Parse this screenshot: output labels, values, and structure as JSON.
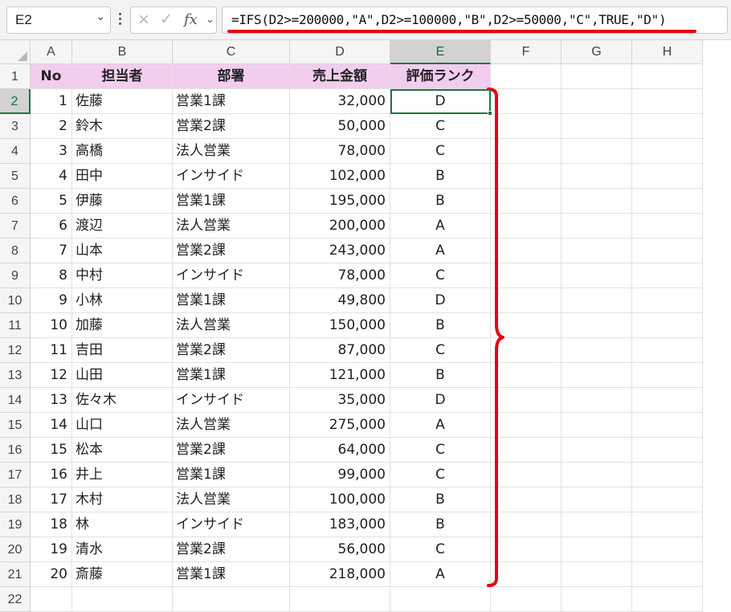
{
  "formula_bar": {
    "name_box": "E2",
    "cancel_icon": "×",
    "enter_icon": "✓",
    "fx_label": "fx",
    "formula": "=IFS(D2>=200000,\"A\",D2>=100000,\"B\",D2>=50000,\"C\",TRUE,\"D\")"
  },
  "columns": [
    "A",
    "B",
    "C",
    "D",
    "E",
    "F",
    "G",
    "H"
  ],
  "selected_column": "E",
  "selected_row": 2,
  "header_row": [
    "No",
    "担当者",
    "部署",
    "売上金額",
    "評価ランク"
  ],
  "rows": [
    [
      "1",
      "佐藤",
      "営業1課",
      "32,000",
      "D"
    ],
    [
      "2",
      "鈴木",
      "営業2課",
      "50,000",
      "C"
    ],
    [
      "3",
      "高橋",
      "法人営業",
      "78,000",
      "C"
    ],
    [
      "4",
      "田中",
      "インサイド",
      "102,000",
      "B"
    ],
    [
      "5",
      "伊藤",
      "営業1課",
      "195,000",
      "B"
    ],
    [
      "6",
      "渡辺",
      "法人営業",
      "200,000",
      "A"
    ],
    [
      "7",
      "山本",
      "営業2課",
      "243,000",
      "A"
    ],
    [
      "8",
      "中村",
      "インサイド",
      "78,000",
      "C"
    ],
    [
      "9",
      "小林",
      "営業1課",
      "49,800",
      "D"
    ],
    [
      "10",
      "加藤",
      "法人営業",
      "150,000",
      "B"
    ],
    [
      "11",
      "吉田",
      "営業2課",
      "87,000",
      "C"
    ],
    [
      "12",
      "山田",
      "営業1課",
      "121,000",
      "B"
    ],
    [
      "13",
      "佐々木",
      "インサイド",
      "35,000",
      "D"
    ],
    [
      "14",
      "山口",
      "法人営業",
      "275,000",
      "A"
    ],
    [
      "15",
      "松本",
      "営業2課",
      "64,000",
      "C"
    ],
    [
      "16",
      "井上",
      "営業1課",
      "99,000",
      "C"
    ],
    [
      "17",
      "木村",
      "法人営業",
      "100,000",
      "B"
    ],
    [
      "18",
      "林",
      "インサイド",
      "183,000",
      "B"
    ],
    [
      "19",
      "清水",
      "営業2課",
      "56,000",
      "C"
    ],
    [
      "20",
      "斎藤",
      "営業1課",
      "218,000",
      "A"
    ]
  ],
  "row_numbers": [
    "1",
    "2",
    "3",
    "4",
    "5",
    "6",
    "7",
    "8",
    "9",
    "10",
    "11",
    "12",
    "13",
    "14",
    "15",
    "16",
    "17",
    "18",
    "19",
    "20",
    "21",
    "22"
  ],
  "colors": {
    "header_fill": "#f2cdee",
    "annotation_red": "#e60012",
    "selection_green": "#217346"
  }
}
